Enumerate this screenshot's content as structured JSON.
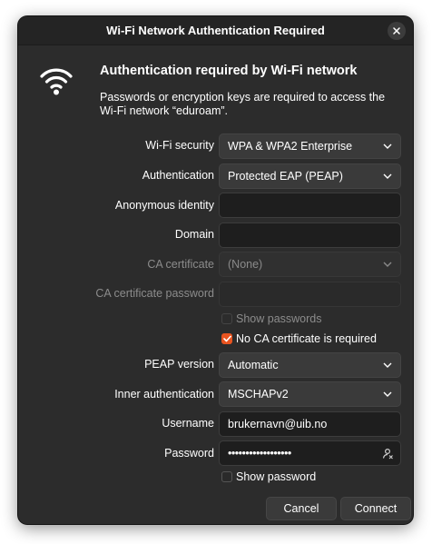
{
  "window": {
    "title": "Wi-Fi Network Authentication Required"
  },
  "header": {
    "heading": "Authentication required by Wi-Fi network",
    "description": "Passwords or encryption keys are required to access the Wi-Fi network “eduroam”."
  },
  "form": {
    "wifi_security": {
      "label": "Wi-Fi security",
      "value": "WPA & WPA2 Enterprise"
    },
    "authentication": {
      "label": "Authentication",
      "value": "Protected EAP (PEAP)"
    },
    "anonymous_identity": {
      "label": "Anonymous identity",
      "value": ""
    },
    "domain": {
      "label": "Domain",
      "value": ""
    },
    "ca_certificate": {
      "label": "CA certificate",
      "value": "(None)"
    },
    "ca_certificate_password": {
      "label": "CA certificate password",
      "value": ""
    },
    "show_passwords": {
      "label": "Show passwords",
      "checked": false
    },
    "no_ca_required": {
      "label": "No CA certificate is required",
      "checked": true
    },
    "peap_version": {
      "label": "PEAP version",
      "value": "Automatic"
    },
    "inner_authentication": {
      "label": "Inner authentication",
      "value": "MSCHAPv2"
    },
    "username": {
      "label": "Username",
      "value": "brukernavn@uib.no"
    },
    "password": {
      "label": "Password",
      "value": "••••••••••••••••••"
    },
    "show_password": {
      "label": "Show password",
      "checked": false
    }
  },
  "buttons": {
    "cancel": "Cancel",
    "connect": "Connect"
  },
  "colors": {
    "accent": "#e95420",
    "dialog_bg": "#2c2c2c",
    "titlebar_bg": "#242424"
  }
}
